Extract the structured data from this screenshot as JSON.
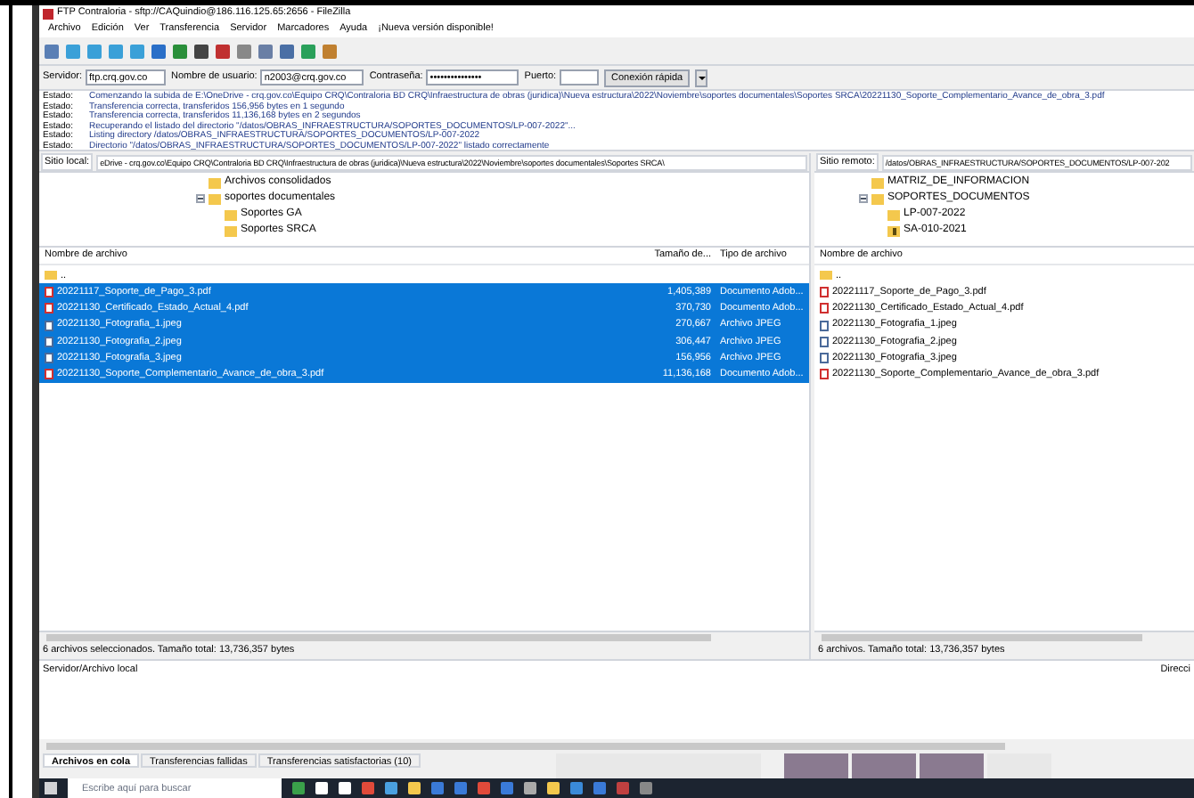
{
  "window": {
    "title": "FTP Contraloria - sftp://CAQuindio@186.116.125.65:2656 - FileZilla"
  },
  "menu": [
    "Archivo",
    "Edición",
    "Ver",
    "Transferencia",
    "Servidor",
    "Marcadores",
    "Ayuda",
    "¡Nueva versión disponible!"
  ],
  "quickconnect": {
    "fields": [
      {
        "label": "Servidor:",
        "value": "ftp.crq.gov.co"
      },
      {
        "label": "Nombre de usuario:",
        "value": "n2003@crq.gov.co"
      },
      {
        "label": "Contraseña:",
        "value": "•••••••••••••••"
      },
      {
        "label": "Puerto:"
      }
    ],
    "button": "Conexión rápida"
  },
  "log": [
    {
      "label": "Estado:",
      "text": "Comenzando la subida de E:\\OneDrive - crq.gov.co\\Equipo CRQ\\Contraloria BD CRQ\\Infraestructura de obras (juridica)\\Nueva estructura\\2022\\Noviembre\\soportes documentales\\Soportes SRCA\\20221130_Soporte_Complementario_Avance_de_obra_3.pdf"
    },
    {
      "label": "Estado:",
      "text": "Transferencia correcta, transferidos 156,956 bytes en 1 segundo"
    },
    {
      "label": "Estado:",
      "text": "Transferencia correcta, transferidos 11,136,168 bytes en 2 segundos"
    },
    {
      "label": "Estado:",
      "text": "Recuperando el listado del directorio \"/datos/OBRAS_INFRAESTRUCTURA/SOPORTES_DOCUMENTOS/LP-007-2022\"..."
    },
    {
      "label": "Estado:",
      "text": "Listing directory /datos/OBRAS_INFRAESTRUCTURA/SOPORTES_DOCUMENTOS/LP-007-2022"
    },
    {
      "label": "Estado:",
      "text": "Directorio \"/datos/OBRAS_INFRAESTRUCTURA/SOPORTES_DOCUMENTOS/LP-007-2022\" listado correctamente"
    }
  ],
  "local": {
    "site_label": "Sitio local:",
    "site_path": "eDrive - crq.gov.co\\Equipo CRQ\\Contraloria BD CRQ\\Infraestructura de obras (juridica)\\Nueva estructura\\2022\\Noviembre\\soportes documentales\\Soportes SRCA\\",
    "tree": [
      {
        "name": "Archivos consolidados"
      },
      {
        "name": "soportes documentales",
        "expanded": true,
        "children": [
          {
            "name": "Soportes GA"
          },
          {
            "name": "Soportes SRCA"
          }
        ]
      }
    ],
    "columns": [
      "Nombre de archivo",
      "Tamaño de...",
      "Tipo de archivo"
    ],
    "rows": [
      {
        "kind": "folder",
        "name": "..",
        "size": "",
        "type": "",
        "selected": false
      },
      {
        "kind": "pdf",
        "name": "20221117_Soporte_de_Pago_3.pdf",
        "size": "1,405,389",
        "type": "Documento Adob...",
        "selected": true
      },
      {
        "kind": "pdf",
        "name": "20221130_Certificado_Estado_Actual_4.pdf",
        "size": "370,730",
        "type": "Documento Adob...",
        "selected": true
      },
      {
        "kind": "image",
        "name": "20221130_Fotografia_1.jpeg",
        "size": "270,667",
        "type": "Archivo JPEG",
        "selected": true
      },
      {
        "kind": "image",
        "name": "20221130_Fotografia_2.jpeg",
        "size": "306,447",
        "type": "Archivo JPEG",
        "selected": true
      },
      {
        "kind": "image",
        "name": "20221130_Fotografia_3.jpeg",
        "size": "156,956",
        "type": "Archivo JPEG",
        "selected": true
      },
      {
        "kind": "pdf",
        "name": "20221130_Soporte_Complementario_Avance_de_obra_3.pdf",
        "size": "11,136,168",
        "type": "Documento Adob...",
        "selected": true
      }
    ],
    "status": "6 archivos seleccionados. Tamaño total: 13,736,357 bytes"
  },
  "remote": {
    "site_label": "Sitio remoto:",
    "site_path": "/datos/OBRAS_INFRAESTRUCTURA/SOPORTES_DOCUMENTOS/LP-007-202",
    "tree": [
      {
        "name": "MATRIZ_DE_INFORMACION"
      },
      {
        "name": "SOPORTES_DOCUMENTOS",
        "expanded": true,
        "children": [
          {
            "name": "LP-007-2022"
          },
          {
            "name": "SA-010-2021",
            "kind": "unknown"
          }
        ]
      }
    ],
    "columns": [
      "Nombre de archivo"
    ],
    "rows": [
      {
        "kind": "folder",
        "name": "..",
        "selected": false
      },
      {
        "kind": "pdf",
        "name": "20221117_Soporte_de_Pago_3.pdf",
        "selected": false
      },
      {
        "kind": "pdf",
        "name": "20221130_Certificado_Estado_Actual_4.pdf",
        "selected": false
      },
      {
        "kind": "image",
        "name": "20221130_Fotografia_1.jpeg",
        "selected": false
      },
      {
        "kind": "image",
        "name": "20221130_Fotografia_2.jpeg",
        "selected": false
      },
      {
        "kind": "image",
        "name": "20221130_Fotografia_3.jpeg",
        "selected": false
      },
      {
        "kind": "pdf",
        "name": "20221130_Soporte_Complementario_Avance_de_obra_3.pdf",
        "selected": false
      }
    ],
    "status": "6 archivos. Tamaño total: 13,736,357 bytes"
  },
  "queue": {
    "columns": [
      "Servidor/Archivo local",
      "Direcci"
    ]
  },
  "tabs": [
    {
      "label": "Archivos en cola",
      "selected": true
    },
    {
      "label": "Transferencias fallidas",
      "selected": false
    },
    {
      "label": "Transferencias satisfactorias (10)",
      "selected": false
    }
  ],
  "taskbar": {
    "search": {
      "placeholder": "Escribe aquí para buscar"
    }
  }
}
